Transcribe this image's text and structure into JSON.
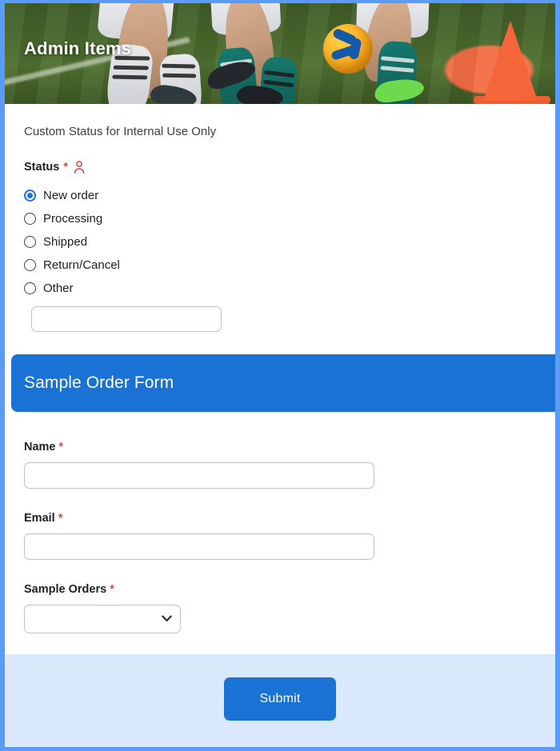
{
  "hero": {
    "title": "Admin Items",
    "image_alt": "youth-soccer-players-with-ball-and-cone"
  },
  "admin_section": {
    "intro": "Custom Status for Internal Use Only",
    "status": {
      "label": "Status",
      "required_marker": "*",
      "icon": "person-icon",
      "icon_color": "#e8453c",
      "options": [
        {
          "label": "New order",
          "selected": true
        },
        {
          "label": "Processing",
          "selected": false
        },
        {
          "label": "Shipped",
          "selected": false
        },
        {
          "label": "Return/Cancel",
          "selected": false
        },
        {
          "label": "Other",
          "selected": false
        }
      ],
      "other_input": {
        "value": "",
        "placeholder": ""
      }
    }
  },
  "form_section": {
    "band_title": "Sample Order Form",
    "band_color": "#1a73d4",
    "fields": [
      {
        "label": "Name",
        "required_marker": "*",
        "type": "text",
        "value": "",
        "placeholder": ""
      },
      {
        "label": "Email",
        "required_marker": "*",
        "type": "text",
        "value": "",
        "placeholder": ""
      },
      {
        "label": "Sample Orders",
        "required_marker": "*",
        "type": "select",
        "value": "",
        "options": [
          ""
        ]
      }
    ]
  },
  "footer": {
    "submit_label": "Submit",
    "background_color": "#d9e9fb",
    "button_color": "#1a73d4"
  },
  "frame": {
    "border_color": "#5b9bf8"
  }
}
